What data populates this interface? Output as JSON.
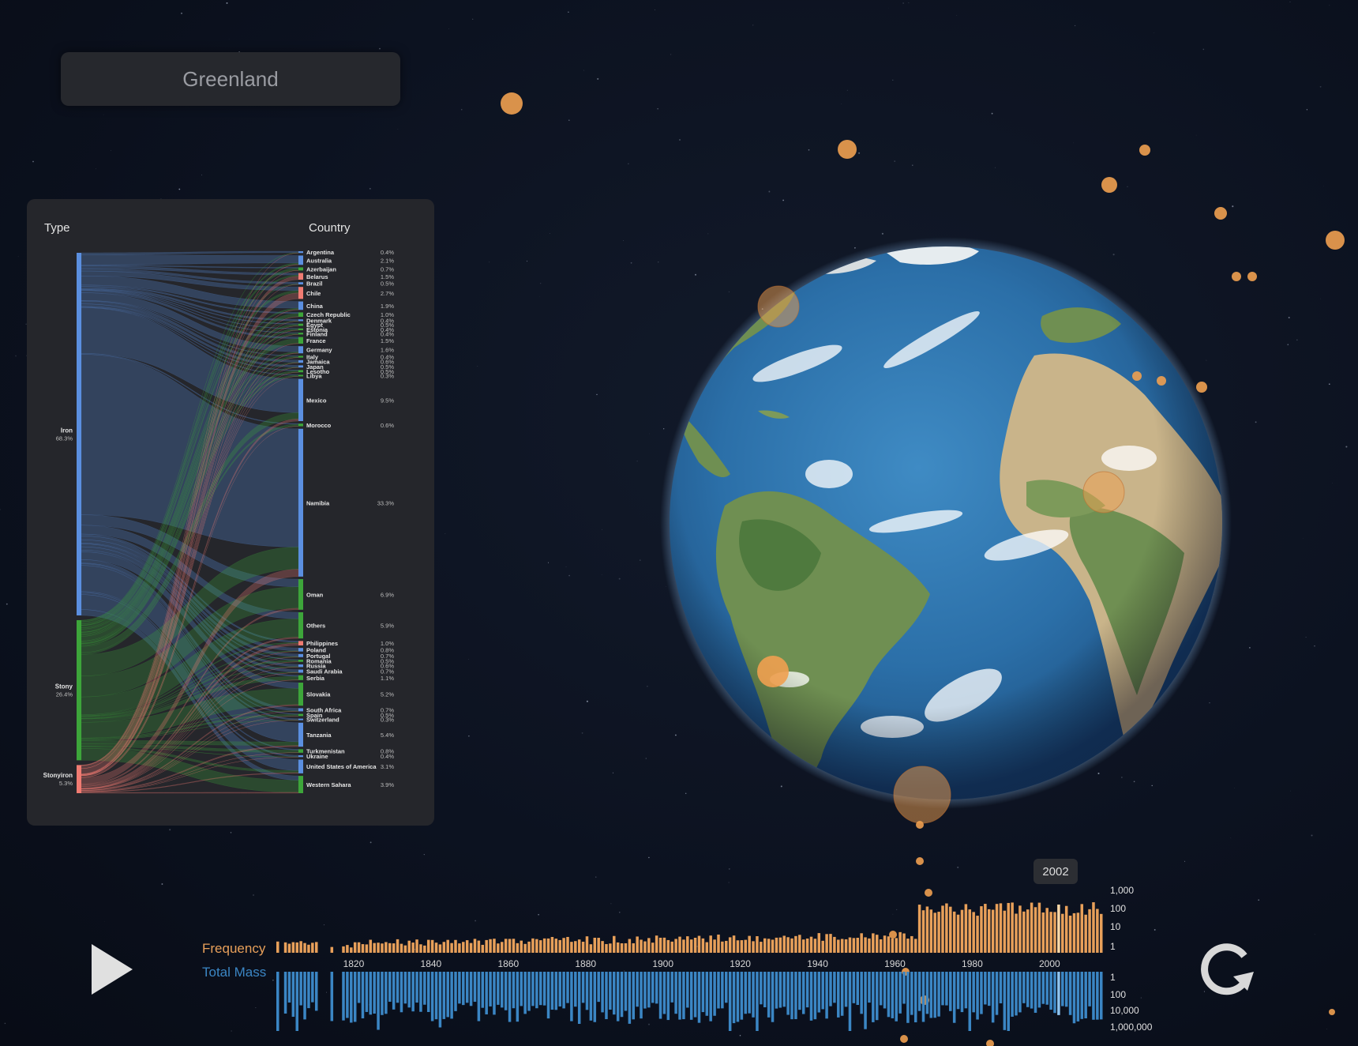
{
  "search": {
    "value": "Greenland"
  },
  "sankey": {
    "header_type": "Type",
    "header_country": "Country",
    "types": [
      {
        "name": "Iron",
        "pct": "68.3%",
        "color": "#5b8fe0"
      },
      {
        "name": "Stony",
        "pct": "26.4%",
        "color": "#3da53a"
      },
      {
        "name": "Stonyiron",
        "pct": "5.3%",
        "color": "#f07b72"
      }
    ],
    "countries": [
      {
        "name": "Argentina",
        "pct": "0.4%",
        "color": "#5b8fe0"
      },
      {
        "name": "Australia",
        "pct": "2.1%",
        "color": "#5b8fe0"
      },
      {
        "name": "Azerbaijan",
        "pct": "0.7%",
        "color": "#3da53a"
      },
      {
        "name": "Belarus",
        "pct": "1.5%",
        "color": "#f07b72"
      },
      {
        "name": "Brazil",
        "pct": "0.5%",
        "color": "#5b8fe0"
      },
      {
        "name": "Chile",
        "pct": "2.7%",
        "color": "#f07b72"
      },
      {
        "name": "China",
        "pct": "1.9%",
        "color": "#5b8fe0"
      },
      {
        "name": "Czech Republic",
        "pct": "1.0%",
        "color": "#3da53a"
      },
      {
        "name": "Denmark",
        "pct": "0.4%",
        "color": "#5b8fe0"
      },
      {
        "name": "Egypt",
        "pct": "0.5%",
        "color": "#3da53a"
      },
      {
        "name": "Estonia",
        "pct": "0.4%",
        "color": "#3da53a"
      },
      {
        "name": "Finland",
        "pct": "0.4%",
        "color": "#3da53a"
      },
      {
        "name": "France",
        "pct": "1.5%",
        "color": "#3da53a"
      },
      {
        "name": "Germany",
        "pct": "1.6%",
        "color": "#5b8fe0"
      },
      {
        "name": "Italy",
        "pct": "0.4%",
        "color": "#3da53a"
      },
      {
        "name": "Jamaica",
        "pct": "0.6%",
        "color": "#5b8fe0"
      },
      {
        "name": "Japan",
        "pct": "0.5%",
        "color": "#5b8fe0"
      },
      {
        "name": "Lesotho",
        "pct": "0.5%",
        "color": "#3da53a"
      },
      {
        "name": "Libya",
        "pct": "0.3%",
        "color": "#3da53a"
      },
      {
        "name": "Mexico",
        "pct": "9.5%",
        "color": "#5b8fe0"
      },
      {
        "name": "Morocco",
        "pct": "0.6%",
        "color": "#3da53a"
      },
      {
        "name": "Namibia",
        "pct": "33.3%",
        "color": "#5b8fe0"
      },
      {
        "name": "Oman",
        "pct": "6.9%",
        "color": "#3da53a"
      },
      {
        "name": "Others",
        "pct": "5.9%",
        "color": "#3da53a"
      },
      {
        "name": "Philippines",
        "pct": "1.0%",
        "color": "#f07b72"
      },
      {
        "name": "Poland",
        "pct": "0.8%",
        "color": "#5b8fe0"
      },
      {
        "name": "Portugal",
        "pct": "0.7%",
        "color": "#5b8fe0"
      },
      {
        "name": "Romania",
        "pct": "0.5%",
        "color": "#3da53a"
      },
      {
        "name": "Russia",
        "pct": "0.6%",
        "color": "#5b8fe0"
      },
      {
        "name": "Saudi Arabia",
        "pct": "0.7%",
        "color": "#5b8fe0"
      },
      {
        "name": "Serbia",
        "pct": "1.1%",
        "color": "#3da53a"
      },
      {
        "name": "Slovakia",
        "pct": "5.2%",
        "color": "#3da53a"
      },
      {
        "name": "South Africa",
        "pct": "0.7%",
        "color": "#5b8fe0"
      },
      {
        "name": "Spain",
        "pct": "0.5%",
        "color": "#3da53a"
      },
      {
        "name": "Switzerland",
        "pct": "0.3%",
        "color": "#5b8fe0"
      },
      {
        "name": "Tanzania",
        "pct": "5.4%",
        "color": "#5b8fe0"
      },
      {
        "name": "Turkmenistan",
        "pct": "0.8%",
        "color": "#3da53a"
      },
      {
        "name": "Ukraine",
        "pct": "0.4%",
        "color": "#5b8fe0"
      },
      {
        "name": "United States of America",
        "pct": "3.1%",
        "color": "#5b8fe0"
      },
      {
        "name": "Western Sahara",
        "pct": "3.9%",
        "color": "#3da53a"
      }
    ]
  },
  "timeline": {
    "frequency_label": "Frequency",
    "mass_label": "Total Mass",
    "frequency_color": "#e8a05a",
    "mass_color": "#3b86c4",
    "year_ticks": [
      "1820",
      "1840",
      "1860",
      "1880",
      "1900",
      "1920",
      "1940",
      "1960",
      "1980",
      "2000"
    ],
    "frequency_axis": [
      "1,000",
      "100",
      "10",
      "1"
    ],
    "mass_axis": [
      "1",
      "100",
      "10,000",
      "1,000,000"
    ],
    "selected_year": "2002",
    "year_range": [
      1800,
      2013
    ]
  },
  "controls": {
    "play_icon": "play-icon",
    "reset_icon": "refresh-icon"
  },
  "colors": {
    "iron": "#5b8fe0",
    "stony": "#3da53a",
    "stonyiron": "#f07b72",
    "impact": "#f0a050"
  }
}
